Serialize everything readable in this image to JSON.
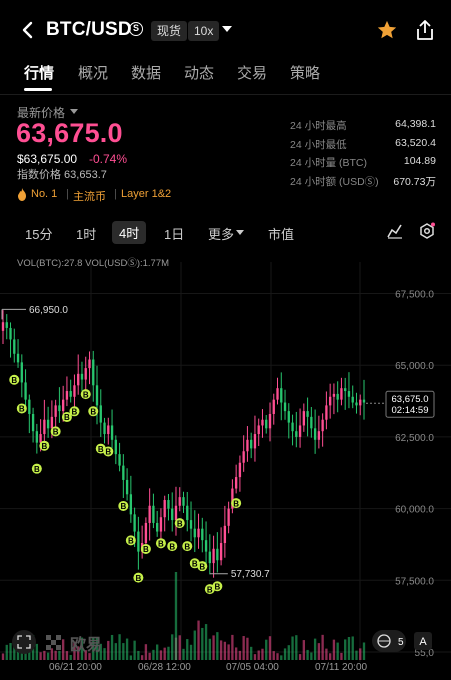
{
  "header": {
    "pair": "BTC/USD",
    "pair_badge": "S",
    "type_chip": "现货",
    "leverage_chip": "10x"
  },
  "tabs": [
    "行情",
    "概况",
    "数据",
    "动态",
    "交易",
    "策略"
  ],
  "price": {
    "label": "最新价格",
    "last": "63,675.0",
    "usd": "$63,675.00",
    "change": "-0.74%",
    "index": "指数价格 63,653.7"
  },
  "stats": [
    {
      "k": "24 小时最高",
      "v": "64,398.1"
    },
    {
      "k": "24 小时最低",
      "v": "63,520.4"
    },
    {
      "k": "24 小时量 (BTC)",
      "v": "104.89"
    },
    {
      "k": "24 小时额 (USDⓈ)",
      "v": "670.73万"
    }
  ],
  "tags": [
    "No. 1",
    "主流币",
    "Layer 1&2"
  ],
  "timeframes": [
    "15分",
    "1时",
    "4时",
    "1日",
    "更多",
    "市值"
  ],
  "volume_legend": "VOL(BTC):27.8  VOL(USDⓈ):1.77M",
  "chart_labels": {
    "high": "66,950.0",
    "low": "57,730.7",
    "last_price": "63,675.0",
    "countdown": "02:14:59",
    "markers": "B",
    "compare_count": "5",
    "compare_label": "A"
  },
  "y_axis": [
    "67,500.0",
    "65,000.0",
    "62,500.0",
    "60,000.0",
    "57,500.0",
    "55,0"
  ],
  "x_axis": [
    "06/21 20:00",
    "06/28 12:00",
    "07/05 04:00",
    "07/11 20:00"
  ],
  "watermark": "欧易",
  "colors": {
    "up": "#ff4f93",
    "down": "#28c76f",
    "accent": "#f0a136",
    "star": "#f0a136"
  },
  "chart_data": {
    "type": "candlestick",
    "ylim": [
      55000,
      68600
    ],
    "high": 66950.0,
    "low": 57730.7,
    "last": 63675.0,
    "closes": [
      66500,
      66300,
      65900,
      65400,
      65100,
      64400,
      63800,
      63300,
      62700,
      62300,
      62600,
      63100,
      62800,
      63200,
      63600,
      63400,
      63800,
      64100,
      63900,
      64300,
      64700,
      64500,
      64900,
      65200,
      64300,
      63600,
      63000,
      62600,
      62900,
      62400,
      61900,
      61500,
      61000,
      60500,
      59800,
      59200,
      58500,
      58800,
      59500,
      60100,
      59500,
      59200,
      59700,
      60300,
      60000,
      59600,
      60100,
      60400,
      60100,
      59600,
      59300,
      59000,
      59300,
      58900,
      58500,
      58100,
      58600,
      58200,
      58800,
      59400,
      60000,
      60700,
      61100,
      61600,
      62000,
      62400,
      62100,
      62600,
      62900,
      63100,
      62800,
      63300,
      63800,
      64200,
      63700,
      63400,
      63000,
      62700,
      62500,
      62900,
      63400,
      63200,
      62800,
      62400,
      62700,
      63100,
      63600,
      63900,
      64000,
      63800,
      64200,
      64100,
      63900,
      63700,
      63600,
      63800,
      63700
    ]
  }
}
